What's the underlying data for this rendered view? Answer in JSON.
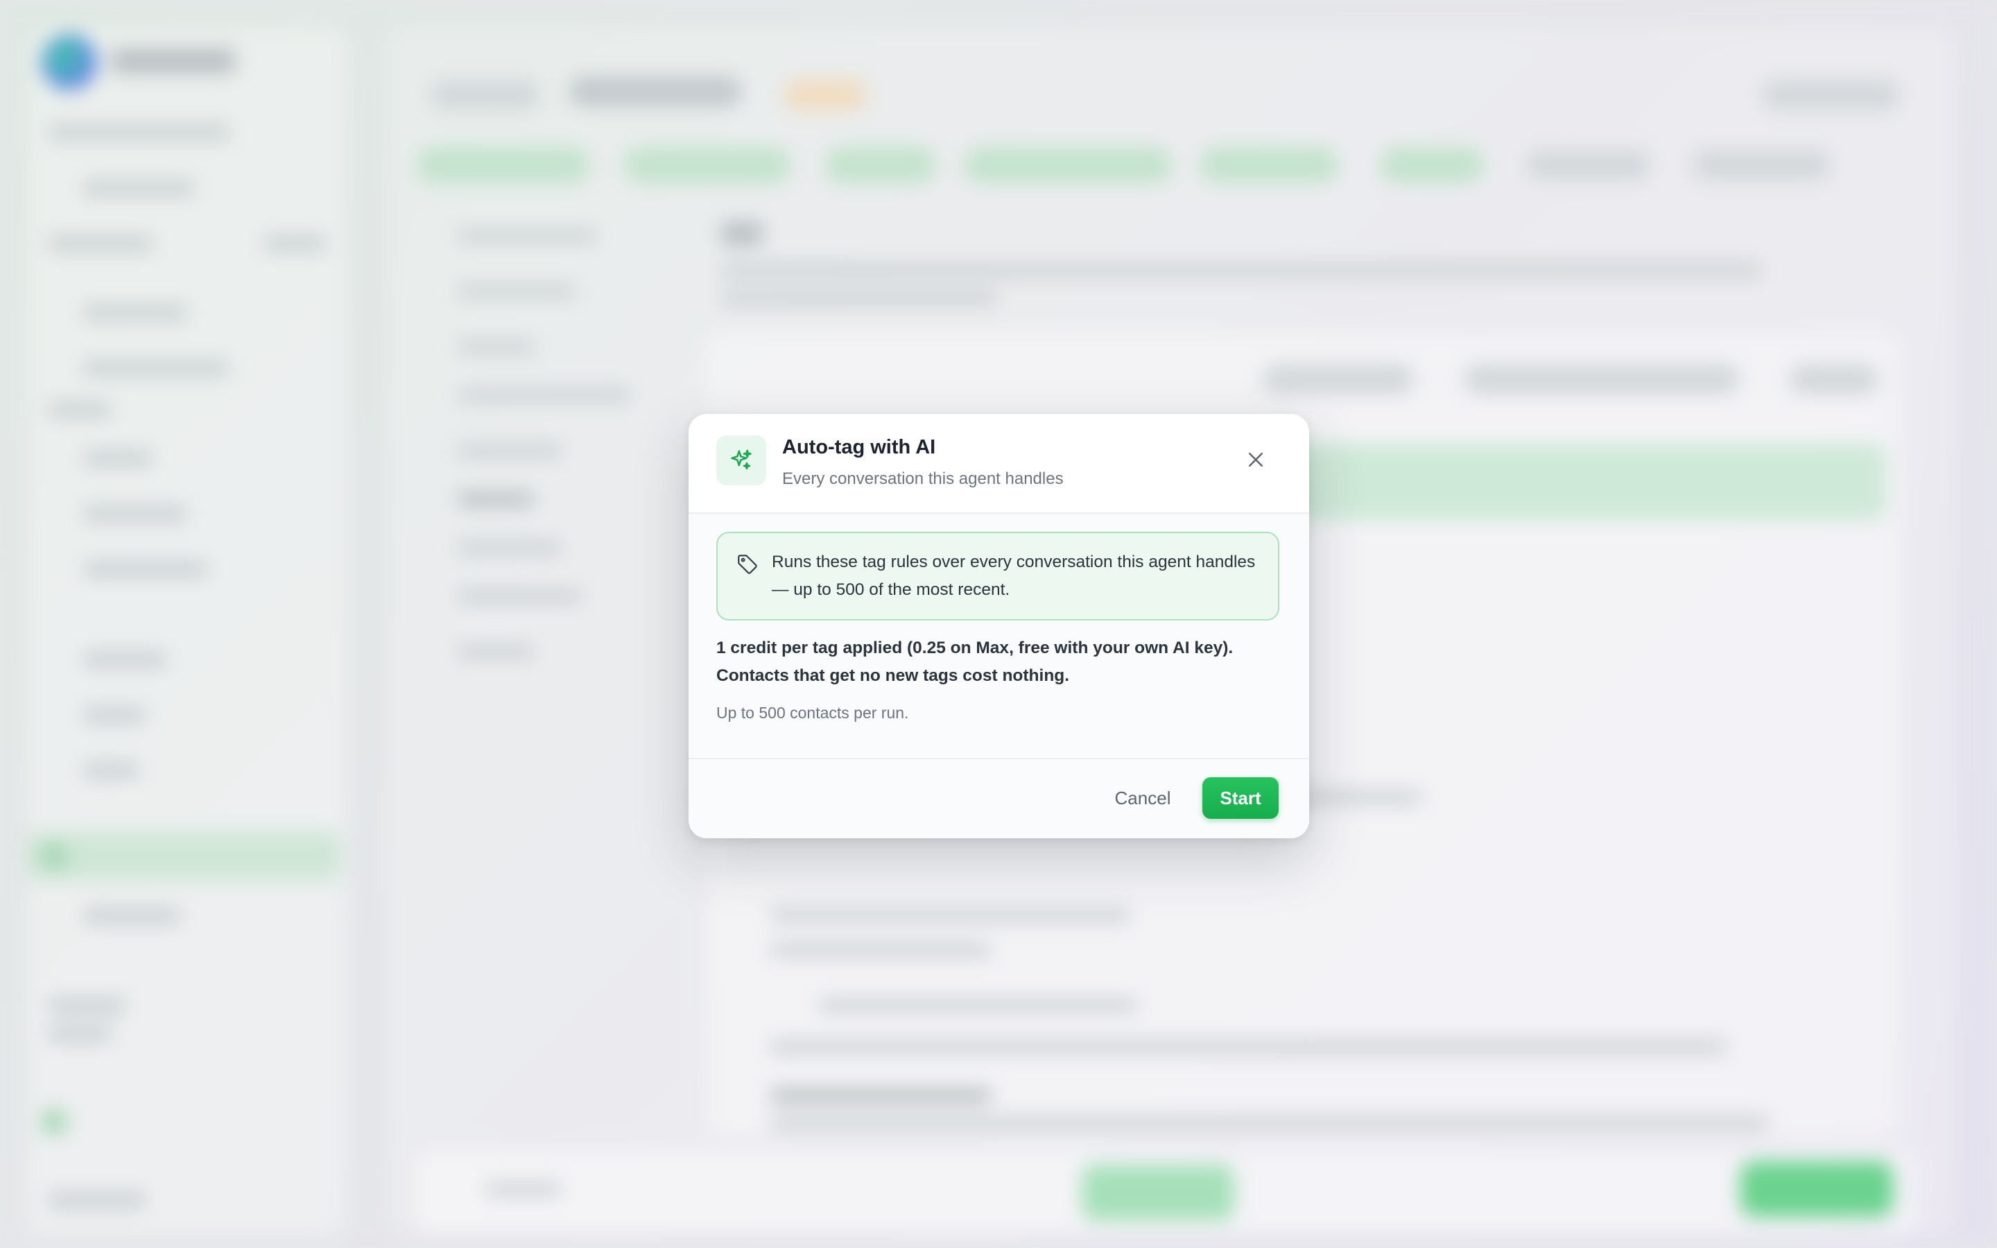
{
  "dialog": {
    "title": "Auto-tag with AI",
    "subtitle": "Every conversation this agent handles",
    "icon": "sparkles-icon",
    "close_icon": "close-icon",
    "info": {
      "icon": "tag-icon",
      "text": "Runs these tag rules over every conversation this agent handles — up to 500 of the most recent."
    },
    "credit_note": "1 credit per tag applied (0.25 on Max, free with your own AI key). Contacts that get no new tags cost nothing.",
    "limit_note": "Up to 500 contacts per run.",
    "cancel_label": "Cancel",
    "start_label": "Start"
  },
  "colors": {
    "accent": "#1fb957",
    "info_border": "#a9e2bc",
    "info_background": "#ecf8f0"
  }
}
